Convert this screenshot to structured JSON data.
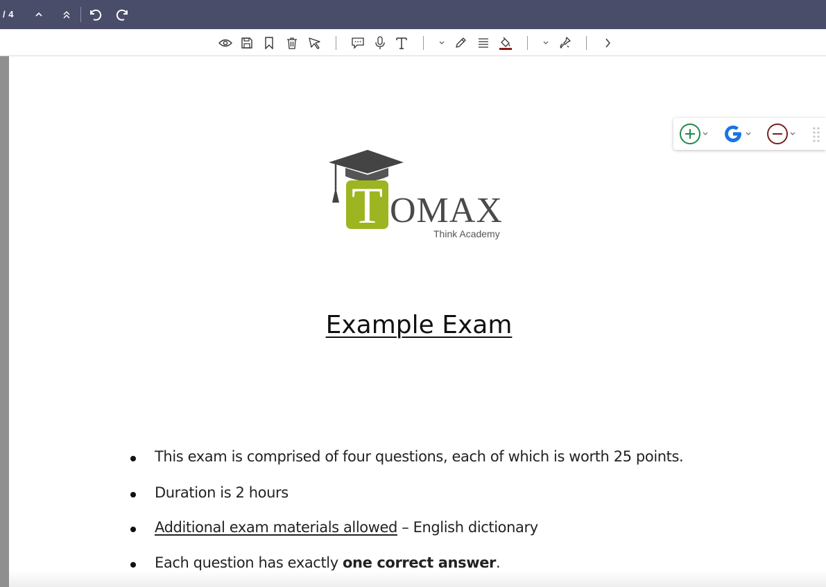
{
  "navigation": {
    "page_count": "/ 4",
    "prev_page": "previous page",
    "first_page": "first page",
    "undo": "undo",
    "redo": "redo"
  },
  "toolbar": {
    "tools": [
      "eye-icon",
      "save-icon",
      "bookmark-icon",
      "trash-icon",
      "select-icon",
      "comment-icon",
      "mic-icon",
      "text-icon",
      "pen-icon",
      "lines-icon",
      "fill-icon",
      "stamp-icon",
      "chevron-right-icon"
    ],
    "fill_color": "#8b1a1a"
  },
  "zoom_widget": {
    "zoom_in_color": "#1e8a4c",
    "google_color": "#1a73e8",
    "zoom_out_color": "#7a1f1f"
  },
  "logo": {
    "letter": "T",
    "name": "OMAX",
    "tagline": "Think Academy",
    "brand_color": "#9db520"
  },
  "document": {
    "title": "Example Exam",
    "bullets": [
      {
        "text": "This exam is comprised of four questions, each of which is worth 25 points."
      },
      {
        "text": "Duration is 2 hours"
      },
      {
        "underlined": "Additional exam materials allowed",
        "rest": " – English dictionary"
      },
      {
        "prefix": "Each question has exactly ",
        "bold": "one correct answer",
        "suffix": "."
      }
    ]
  }
}
